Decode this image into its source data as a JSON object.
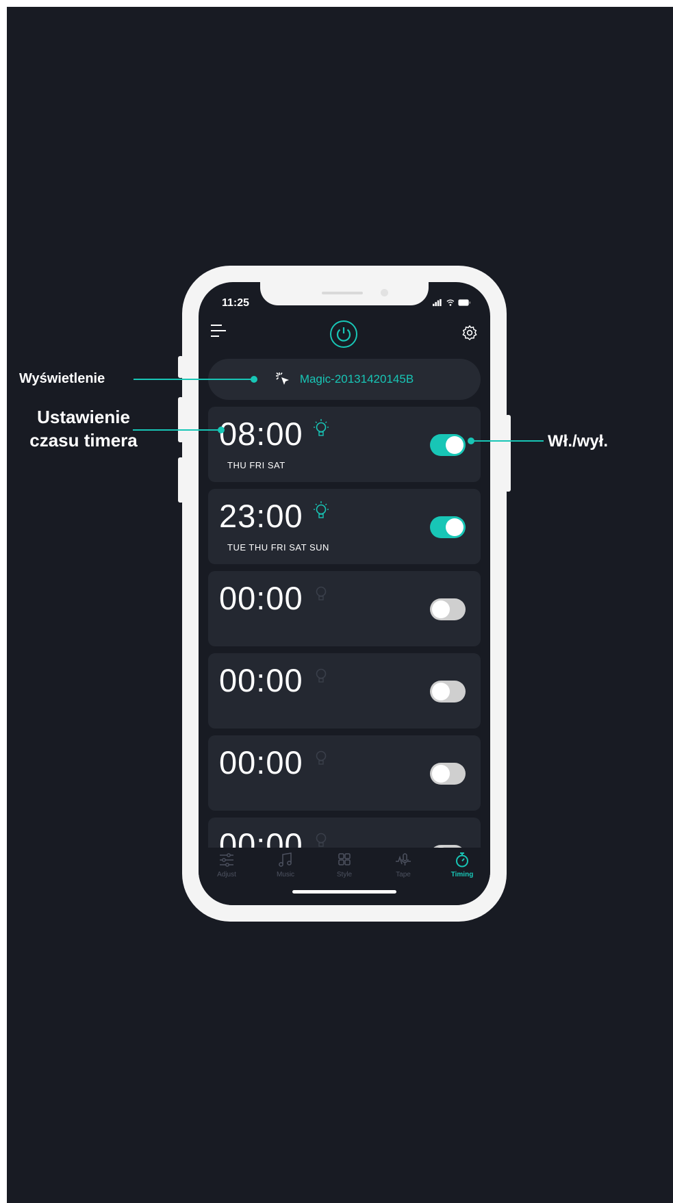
{
  "callouts": {
    "display": "Wyświetlenie",
    "timer_line1": "Ustawienie",
    "timer_line2": "czasu timera",
    "onoff": "Wł./wył."
  },
  "status_bar": {
    "time": "11:25"
  },
  "header": {
    "menu_icon": "menu-icon",
    "power_icon": "power-icon",
    "settings_icon": "gear-icon"
  },
  "device": {
    "name": "Magic-20131420145B",
    "icon": "magic-cursor-icon"
  },
  "timers": [
    {
      "time": "08:00",
      "days": "THU  FRI  SAT",
      "enabled": true,
      "bulb_lit": true
    },
    {
      "time": "23:00",
      "days": "TUE  THU  FRI  SAT  SUN",
      "enabled": true,
      "bulb_lit": true
    },
    {
      "time": "00:00",
      "days": "",
      "enabled": false,
      "bulb_lit": false
    },
    {
      "time": "00:00",
      "days": "",
      "enabled": false,
      "bulb_lit": false
    },
    {
      "time": "00:00",
      "days": "",
      "enabled": false,
      "bulb_lit": false
    },
    {
      "time": "00:00",
      "days": "",
      "enabled": false,
      "bulb_lit": false
    }
  ],
  "tabs": [
    {
      "label": "Adjust",
      "icon": "sliders-icon"
    },
    {
      "label": "Music",
      "icon": "music-icon"
    },
    {
      "label": "Style",
      "icon": "grid-icon"
    },
    {
      "label": "Tape",
      "icon": "mic-wave-icon"
    },
    {
      "label": "Timing",
      "icon": "timer-icon",
      "active": true
    }
  ],
  "colors": {
    "accent": "#18c6b6",
    "background": "#181b23",
    "card": "#242831",
    "inactive": "#4d5260"
  }
}
